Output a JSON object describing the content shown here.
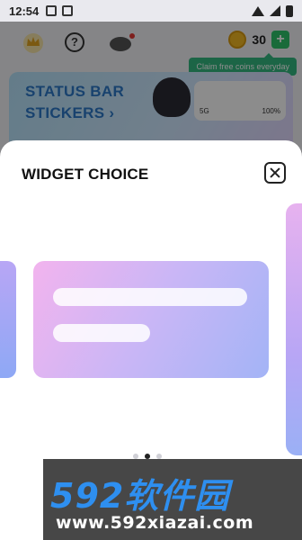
{
  "status_bar": {
    "time": "12:54",
    "icons": [
      "qr-icon",
      "a-icon",
      "wifi-icon",
      "signal-icon",
      "battery-icon"
    ]
  },
  "app": {
    "help_label": "?",
    "coins": "30",
    "add_label": "+",
    "tooltip": "Claim free coins everyday",
    "banner": {
      "title_line1": "STATUS BAR",
      "title_line2": "STICKERS",
      "arrow": "›",
      "phone_signal": "5G",
      "phone_battery": "100%"
    }
  },
  "sheet": {
    "title": "WIDGET CHOICE",
    "pager": {
      "count": 3,
      "active": 1
    }
  },
  "watermark": {
    "logo": "592软件园",
    "url": "www.592xiazai.com"
  },
  "colors": {
    "accent_green": "#34b980",
    "coin_gold": "#f2b824",
    "banner_blue": "#2d78c8"
  }
}
